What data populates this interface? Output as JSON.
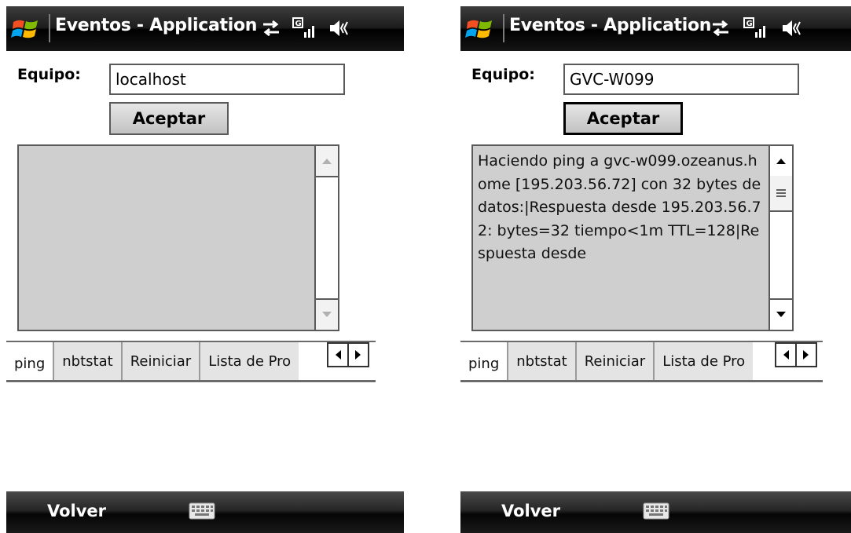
{
  "screens": [
    {
      "title": "Eventos - Application",
      "equipo_label": "Equipo:",
      "equipo_value": "localhost",
      "accept_label": "Aceptar",
      "output_text": "",
      "tabs": [
        "ping",
        "nbtstat",
        "Reiniciar",
        "Lista de Pro"
      ],
      "active_tab": "ping",
      "soft_left": "Volver"
    },
    {
      "title": "Eventos - Application",
      "equipo_label": "Equipo:",
      "equipo_value": "GVC-W099",
      "accept_label": "Aceptar",
      "output_text": "Haciendo ping a gvc-w099.ozeanus.home [195.203.56.72] con 32 bytes de datos:|Respuesta desde 195.203.56.72: bytes=32 tiempo<1m TTL=128|Respuesta desde",
      "tabs": [
        "ping",
        "nbtstat",
        "Reiniciar",
        "Lista de Pro"
      ],
      "active_tab": "ping",
      "soft_left": "Volver"
    }
  ],
  "icons": {
    "start": "windows-start-icon",
    "connectivity": "data-connection-icon",
    "signal": "signal-strength-icon",
    "volume": "speaker-icon",
    "keyboard": "keyboard-icon"
  },
  "colors": {
    "titlebar": "#1c1c1c",
    "output_bg": "#cfcfcf",
    "tab_bg": "#e4e4e4",
    "text": "#000000"
  }
}
